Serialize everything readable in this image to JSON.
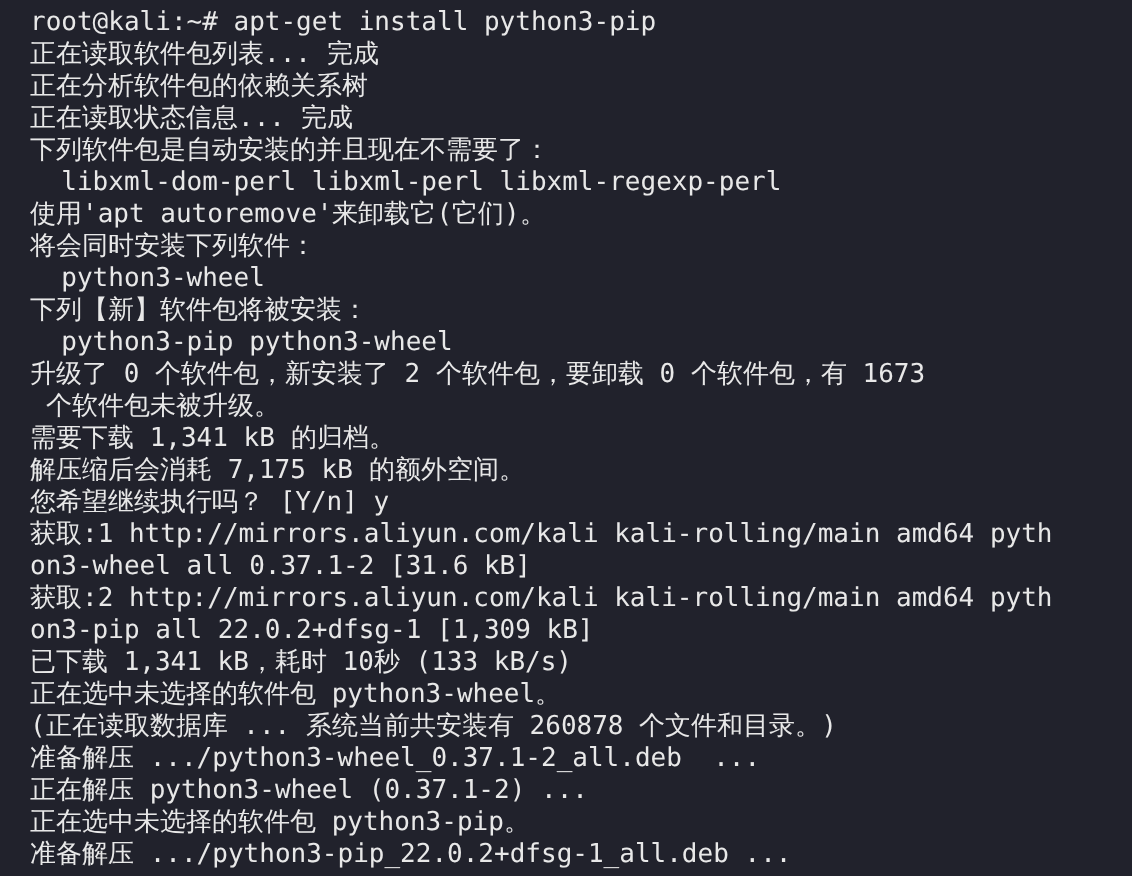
{
  "terminal": {
    "lines": [
      "root@kali:~# apt-get install python3-pip",
      "正在读取软件包列表... 完成",
      "正在分析软件包的依赖关系树",
      "正在读取状态信息... 完成",
      "下列软件包是自动安装的并且现在不需要了：",
      "  libxml-dom-perl libxml-perl libxml-regexp-perl",
      "使用'apt autoremove'来卸载它(它们)。",
      "将会同时安装下列软件：",
      "  python3-wheel",
      "下列【新】软件包将被安装：",
      "  python3-pip python3-wheel",
      "升级了 0 个软件包，新安装了 2 个软件包，要卸载 0 个软件包，有 1673",
      " 个软件包未被升级。",
      "需要下载 1,341 kB 的归档。",
      "解压缩后会消耗 7,175 kB 的额外空间。",
      "您希望继续执行吗？ [Y/n] y",
      "获取:1 http://mirrors.aliyun.com/kali kali-rolling/main amd64 pyth",
      "on3-wheel all 0.37.1-2 [31.6 kB]",
      "获取:2 http://mirrors.aliyun.com/kali kali-rolling/main amd64 pyth",
      "on3-pip all 22.0.2+dfsg-1 [1,309 kB]",
      "已下载 1,341 kB，耗时 10秒 (133 kB/s)",
      "正在选中未选择的软件包 python3-wheel。",
      "(正在读取数据库 ... 系统当前共安装有 260878 个文件和目录。)",
      "准备解压 .../python3-wheel_0.37.1-2_all.deb  ...",
      "正在解压 python3-wheel (0.37.1-2) ...",
      "正在选中未选择的软件包 python3-pip。",
      "准备解压 .../python3-pip_22.0.2+dfsg-1_all.deb ..."
    ]
  }
}
